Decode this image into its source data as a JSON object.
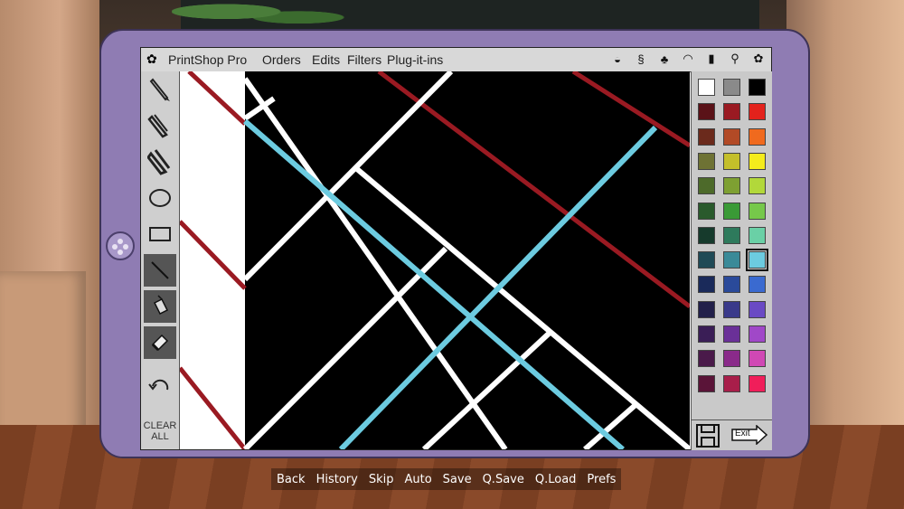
{
  "app": {
    "title": "PrintShop Pro",
    "menus": [
      "Orders",
      "Edits",
      "Filters",
      "Plug-it-ins"
    ]
  },
  "tools": {
    "clear_label_line1": "CLEAR",
    "clear_label_line2": "ALL"
  },
  "palette": {
    "colors": [
      "#ffffff",
      "#8a8a8a",
      "#000000",
      "#5a1218",
      "#9a1a22",
      "#e3221c",
      "#6b2a1c",
      "#b24a26",
      "#f06a1e",
      "#6e7234",
      "#c4bf2a",
      "#f4ec1c",
      "#4d6a2a",
      "#7ea032",
      "#b2d83a",
      "#2a5a2c",
      "#3a9a36",
      "#76c84a",
      "#163a2c",
      "#2e7a5c",
      "#6ad0a6",
      "#1f4a56",
      "#3a8a98",
      "#6ccbe0",
      "#1a2a5a",
      "#2a4a9a",
      "#3a6ad0",
      "#22204a",
      "#3a3a8a",
      "#6a4ac4",
      "#3a1e56",
      "#6a3098",
      "#a048c8",
      "#4a1a4a",
      "#8a2a8a",
      "#d048b4",
      "#5a1438",
      "#a81e4a",
      "#f01e5a"
    ],
    "selected_color": "#6ccbe0",
    "exit_label": "Exit"
  },
  "canvas": {
    "background": "#000000",
    "stroke_colors": [
      "#ffffff",
      "#9a1a22",
      "#6ccbe0"
    ]
  },
  "vn_menu": [
    "Back",
    "History",
    "Skip",
    "Auto",
    "Save",
    "Q.Save",
    "Q.Load",
    "Prefs"
  ]
}
